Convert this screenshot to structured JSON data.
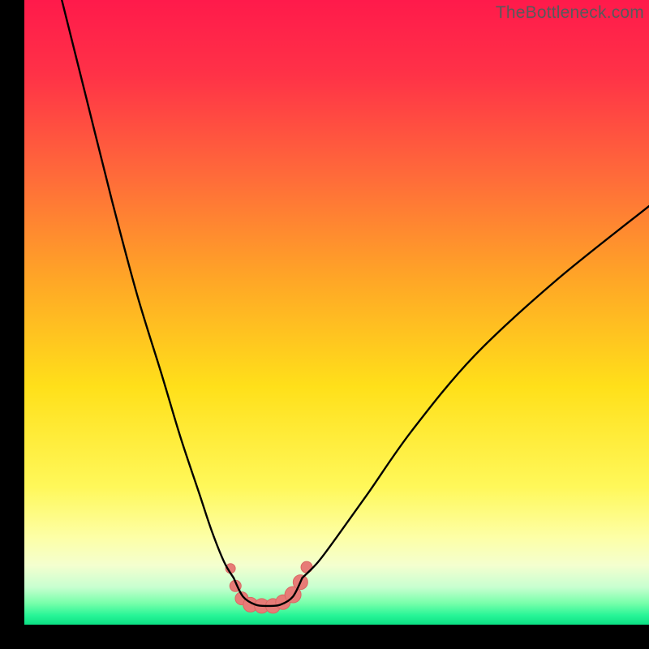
{
  "watermark": "TheBottleneck.com",
  "colors": {
    "gradient_stops": [
      {
        "offset": 0.0,
        "color": "#ff1a4b"
      },
      {
        "offset": 0.12,
        "color": "#ff3247"
      },
      {
        "offset": 0.28,
        "color": "#ff6a3a"
      },
      {
        "offset": 0.45,
        "color": "#ffa726"
      },
      {
        "offset": 0.62,
        "color": "#ffe01a"
      },
      {
        "offset": 0.78,
        "color": "#fff85a"
      },
      {
        "offset": 0.86,
        "color": "#fdffa6"
      },
      {
        "offset": 0.905,
        "color": "#f4ffcf"
      },
      {
        "offset": 0.94,
        "color": "#c8ffd0"
      },
      {
        "offset": 0.965,
        "color": "#7affab"
      },
      {
        "offset": 0.985,
        "color": "#28f597"
      },
      {
        "offset": 1.0,
        "color": "#0be084"
      }
    ],
    "curve": "#000000",
    "marker_fill": "#e77b77",
    "marker_stroke": "#d96863",
    "frame": "#000000"
  },
  "chart_data": {
    "type": "line",
    "title": "",
    "xlabel": "",
    "ylabel": "",
    "xlim": [
      0,
      100
    ],
    "ylim": [
      0,
      100
    ],
    "grid": false,
    "series": [
      {
        "name": "left-branch",
        "x": [
          6,
          10,
          14,
          18,
          22,
          25,
          28,
          30,
          32,
          33.5
        ],
        "y": [
          100,
          84,
          68,
          53,
          40,
          30,
          21,
          15,
          10,
          7.5
        ]
      },
      {
        "name": "right-branch",
        "x": [
          44.5,
          47,
          50,
          55,
          62,
          72,
          85,
          100
        ],
        "y": [
          7.5,
          10,
          14,
          21,
          31,
          43,
          55,
          67
        ]
      },
      {
        "name": "valley-floor",
        "x": [
          33.5,
          35,
          37,
          39,
          41,
          43,
          44.5
        ],
        "y": [
          7.5,
          4.5,
          3.2,
          3.0,
          3.2,
          4.5,
          7.5
        ]
      }
    ],
    "markers": {
      "name": "valley-markers",
      "points": [
        {
          "x": 33.0,
          "y": 9.0,
          "r": 6
        },
        {
          "x": 33.8,
          "y": 6.2,
          "r": 7
        },
        {
          "x": 34.8,
          "y": 4.2,
          "r": 8
        },
        {
          "x": 36.2,
          "y": 3.2,
          "r": 9
        },
        {
          "x": 38.0,
          "y": 3.0,
          "r": 9
        },
        {
          "x": 39.8,
          "y": 3.0,
          "r": 9
        },
        {
          "x": 41.4,
          "y": 3.6,
          "r": 9
        },
        {
          "x": 43.0,
          "y": 4.8,
          "r": 10
        },
        {
          "x": 44.2,
          "y": 6.8,
          "r": 9
        },
        {
          "x": 45.2,
          "y": 9.2,
          "r": 7
        }
      ]
    }
  }
}
